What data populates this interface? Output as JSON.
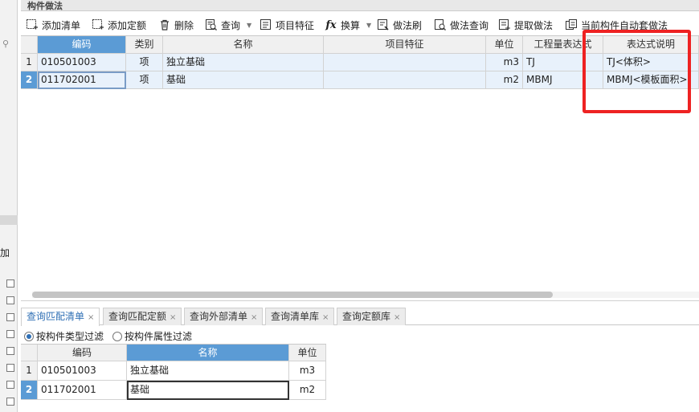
{
  "panel_title": "构件做法",
  "toolbar": {
    "add_list": "添加清单",
    "add_quota": "添加定额",
    "delete": "删除",
    "query": "查询",
    "item_feature": "项目特征",
    "convert": "换算",
    "method_brush": "做法刷",
    "method_query": "做法查询",
    "extract_method": "提取做法",
    "auto_assign": "当前构件自动套做法"
  },
  "main_grid": {
    "columns": [
      "编码",
      "类别",
      "名称",
      "项目特征",
      "单位",
      "工程量表达式",
      "表达式说明"
    ],
    "rows": [
      {
        "num": "1",
        "code": "010501003",
        "type": "项",
        "name": "独立基础",
        "feature": "",
        "unit": "m3",
        "expr": "TJ",
        "expr_desc": "TJ<体积>"
      },
      {
        "num": "2",
        "code": "011702001",
        "type": "项",
        "name": "基础",
        "feature": "",
        "unit": "m2",
        "expr": "MBMJ",
        "expr_desc": "MBMJ<模板面积>"
      }
    ]
  },
  "bottom_tabs": [
    "查询匹配清单",
    "查询匹配定额",
    "查询外部清单",
    "查询清单库",
    "查询定额库"
  ],
  "filters": {
    "by_type": "按构件类型过滤",
    "by_attr": "按构件属性过滤"
  },
  "match_grid": {
    "columns": [
      "编码",
      "名称",
      "单位"
    ],
    "rows": [
      {
        "num": "1",
        "code": "010501003",
        "name": "独立基础",
        "unit": "m3"
      },
      {
        "num": "2",
        "code": "011702001",
        "name": "基础",
        "unit": "m2"
      }
    ]
  },
  "left_strip": {
    "plus_label": "加"
  },
  "colors": {
    "accent": "#5b9bd5",
    "row_bg": "#e8f1fb",
    "highlight": "#ee2222"
  }
}
